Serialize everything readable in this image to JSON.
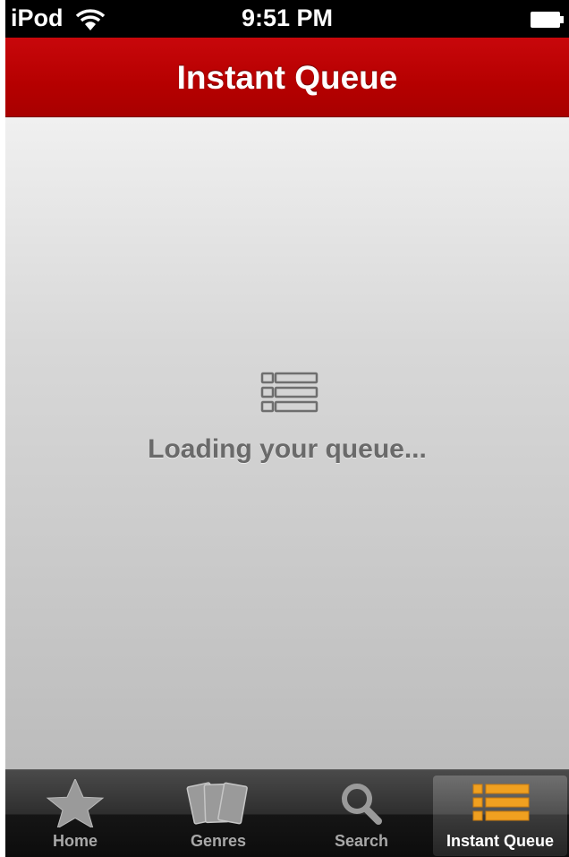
{
  "status_bar": {
    "carrier": "iPod",
    "time": "9:51 PM"
  },
  "nav": {
    "title": "Instant Queue"
  },
  "content": {
    "loading_text": "Loading your queue..."
  },
  "tab_bar": {
    "tabs": [
      {
        "label": "Home",
        "icon": "star-icon",
        "selected": false
      },
      {
        "label": "Genres",
        "icon": "cards-icon",
        "selected": false
      },
      {
        "label": "Search",
        "icon": "search-icon",
        "selected": false
      },
      {
        "label": "Instant Queue",
        "icon": "queue-list-icon",
        "selected": true
      }
    ]
  },
  "colors": {
    "nav_red": "#b50000",
    "selected_icon": "#f0a020",
    "tab_icon": "#9a9a9a"
  }
}
